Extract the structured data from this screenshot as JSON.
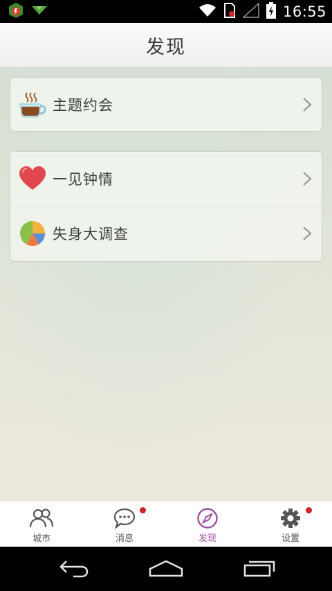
{
  "status_bar": {
    "time": "16:55",
    "icons": [
      "app-notification-icon",
      "download-icon",
      "wifi-icon",
      "sim-icon",
      "signal-icon",
      "battery-icon"
    ]
  },
  "header": {
    "title": "发现"
  },
  "groups": [
    {
      "items": [
        {
          "label": "主题约会",
          "icon": "coffee-cup-icon"
        }
      ]
    },
    {
      "items": [
        {
          "label": "一见钟情",
          "icon": "heart-icon"
        },
        {
          "label": "失身大调查",
          "icon": "pie-chart-icon"
        }
      ]
    }
  ],
  "tabs": [
    {
      "label": "城市",
      "icon": "people-icon",
      "badge": false,
      "active": false
    },
    {
      "label": "消息",
      "icon": "chat-bubble-icon",
      "badge": true,
      "active": false
    },
    {
      "label": "发现",
      "icon": "compass-icon",
      "badge": false,
      "active": true
    },
    {
      "label": "设置",
      "icon": "gear-icon",
      "badge": true,
      "active": false
    }
  ],
  "nav_bar": {
    "buttons": [
      "back-icon",
      "home-icon",
      "recents-icon"
    ]
  },
  "colors": {
    "active_tab": "#9b4fa2",
    "badge": "#d0232b",
    "heart": "#e0484e",
    "text": "#3f3f3f"
  }
}
